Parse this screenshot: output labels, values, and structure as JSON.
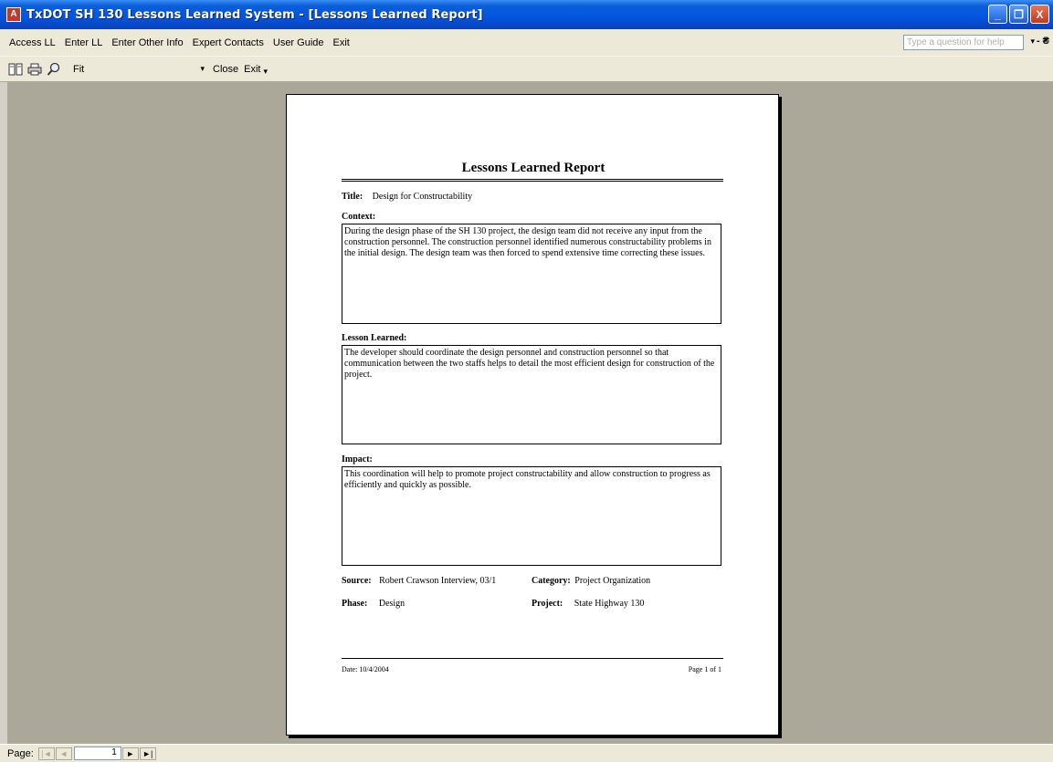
{
  "window": {
    "title": "TxDOT SH 130 Lessons Learned System - [Lessons Learned Report]",
    "controls": [
      "_",
      "❐",
      "X"
    ]
  },
  "menu": {
    "items": [
      "Access LL",
      "Enter LL",
      "Enter Other Info",
      "Expert Contacts",
      "User Guide",
      "Exit"
    ],
    "help_placeholder": "Type a question for help",
    "doc_control": "- ₴"
  },
  "toolbar": {
    "zoom_value": "Fit",
    "close_label": "Close",
    "exit_label": "Exit",
    "icons": [
      "view-icon",
      "print-icon",
      "zoom-icon"
    ]
  },
  "report": {
    "title": "Lessons Learned Report",
    "title_label": "Title:",
    "title_value": "Design for Constructability",
    "context_label": "Context:",
    "context_text": "During the design phase of the SH 130 project, the design team did not receive any input from the construction personnel. The construction personnel identified numerous constructability problems in the initial design. The design team was then forced to spend extensive time correcting these issues.",
    "lesson_label": "Lesson Learned:",
    "lesson_text": "The developer should coordinate the design personnel and construction personnel so that communication between the two staffs helps to detail the most efficient design for construction of the project.",
    "impact_label": "Impact:",
    "impact_text": "This coordination will help to promote project constructability and allow construction to progress as efficiently and quickly as possible.",
    "source_label": "Source:",
    "source_value": "Robert Crawson Interview, 03/1",
    "category_label": "Category:",
    "category_value": "Project Organization",
    "phase_label": "Phase:",
    "phase_value": "Design",
    "project_label": "Project:",
    "project_value": "State Highway 130",
    "footer_date": "Date: 10/4/2004",
    "footer_page": "Page 1 of 1"
  },
  "statusbar": {
    "page_label": "Page:",
    "page_number": "1"
  }
}
